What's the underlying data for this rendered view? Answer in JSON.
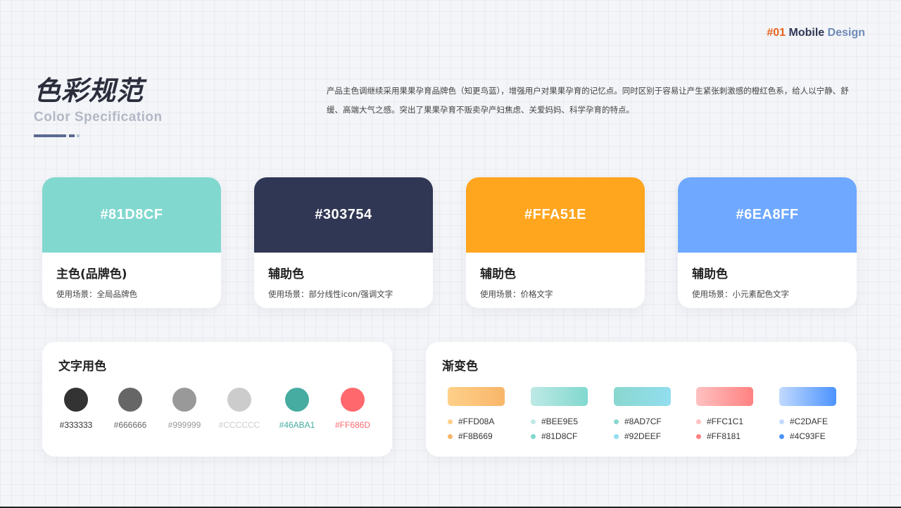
{
  "header": {
    "num": "#01",
    "mobile": "Mobile",
    "design": "Design"
  },
  "title": "色彩规范",
  "subtitle": "Color Specification",
  "intro": "产品主色调继续采用果果孕育品牌色（知更鸟蓝），增强用户对果果孕育的记忆点。同时区别于容易让产生紧张刺激感的橙红色系，给人以宁静、舒缓、高端大气之感。突出了果果孕育不贩卖孕产妇焦虑、关爱妈妈、科学孕育的特点。",
  "colors": {
    "accent_title": "#2b2f3d",
    "accent_orange": "#e7621c"
  },
  "cards": [
    {
      "hex": "#81D8CF",
      "color": "#81D8CF",
      "name": "主色(品牌色)",
      "usage": "使用场景：全局品牌色"
    },
    {
      "hex": "#303754",
      "color": "#303754",
      "name": "辅助色",
      "usage": "使用场景：部分线性icon/强调文字"
    },
    {
      "hex": "#FFA51E",
      "color": "#FFA51E",
      "name": "辅助色",
      "usage": "使用场景：价格文字"
    },
    {
      "hex": "#6EA8FF",
      "color": "#6EA8FF",
      "name": "辅助色",
      "usage": "使用场景：小元素配色文字"
    }
  ],
  "text_colors": {
    "title": "文字用色",
    "items": [
      {
        "label": "#333333",
        "color": "#333333"
      },
      {
        "label": "#666666",
        "color": "#666666"
      },
      {
        "label": "#999999",
        "color": "#999999"
      },
      {
        "label": "#CCCCCC",
        "color": "#CCCCCC"
      },
      {
        "label": "#46ABA1",
        "color": "#46ABA1"
      },
      {
        "label": "#FF686D",
        "color": "#FF686D"
      }
    ]
  },
  "gradients": {
    "title": "渐变色",
    "items": [
      {
        "from": "#FFD08A",
        "to": "#F8B669"
      },
      {
        "from": "#BEE9E5",
        "to": "#81D8CF"
      },
      {
        "from": "#8AD7CF",
        "to": "#92DEEF"
      },
      {
        "from": "#FFC1C1",
        "to": "#FF8181"
      },
      {
        "from": "#C2DAFE",
        "to": "#4C93FE"
      }
    ]
  }
}
